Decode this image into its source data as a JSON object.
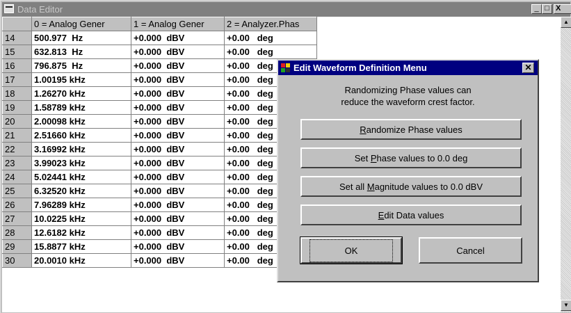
{
  "window": {
    "title": "Data Editor",
    "minimize_glyph": "_",
    "maximize_glyph": "□",
    "close_glyph": "X"
  },
  "grid": {
    "columns": [
      "",
      "0 = Analog Gener",
      "1 = Analog Gener",
      "2 = Analyzer.Phas"
    ],
    "rows": [
      {
        "num": "14",
        "c0": "500.977  Hz",
        "c1": "+0.000  dBV",
        "c2": "+0.00   deg"
      },
      {
        "num": "15",
        "c0": "632.813  Hz",
        "c1": "+0.000  dBV",
        "c2": "+0.00   deg"
      },
      {
        "num": "16",
        "c0": "796.875  Hz",
        "c1": "+0.000  dBV",
        "c2": "+0.00   deg"
      },
      {
        "num": "17",
        "c0": "1.00195 kHz",
        "c1": "+0.000  dBV",
        "c2": "+0.00   deg"
      },
      {
        "num": "18",
        "c0": "1.26270 kHz",
        "c1": "+0.000  dBV",
        "c2": "+0.00   deg"
      },
      {
        "num": "19",
        "c0": "1.58789 kHz",
        "c1": "+0.000  dBV",
        "c2": "+0.00   deg"
      },
      {
        "num": "20",
        "c0": "2.00098 kHz",
        "c1": "+0.000  dBV",
        "c2": "+0.00   deg"
      },
      {
        "num": "21",
        "c0": "2.51660 kHz",
        "c1": "+0.000  dBV",
        "c2": "+0.00   deg"
      },
      {
        "num": "22",
        "c0": "3.16992 kHz",
        "c1": "+0.000  dBV",
        "c2": "+0.00   deg"
      },
      {
        "num": "23",
        "c0": "3.99023 kHz",
        "c1": "+0.000  dBV",
        "c2": "+0.00   deg"
      },
      {
        "num": "24",
        "c0": "5.02441 kHz",
        "c1": "+0.000  dBV",
        "c2": "+0.00   deg"
      },
      {
        "num": "25",
        "c0": "6.32520 kHz",
        "c1": "+0.000  dBV",
        "c2": "+0.00   deg"
      },
      {
        "num": "26",
        "c0": "7.96289 kHz",
        "c1": "+0.000  dBV",
        "c2": "+0.00   deg"
      },
      {
        "num": "27",
        "c0": "10.0225 kHz",
        "c1": "+0.000  dBV",
        "c2": "+0.00   deg"
      },
      {
        "num": "28",
        "c0": "12.6182 kHz",
        "c1": "+0.000  dBV",
        "c2": "+0.00   deg"
      },
      {
        "num": "29",
        "c0": "15.8877 kHz",
        "c1": "+0.000  dBV",
        "c2": "+0.00   deg"
      },
      {
        "num": "30",
        "c0": "20.0010 kHz",
        "c1": "+0.000  dBV",
        "c2": "+0.00   deg"
      }
    ]
  },
  "dialog": {
    "title": "Edit Waveform Definition Menu",
    "close_glyph": "✕",
    "message_line1": "Randomizing Phase values can",
    "message_line2": "reduce the waveform crest factor.",
    "randomize": {
      "pre": "",
      "key": "R",
      "post": "andomize Phase values"
    },
    "set_phase": {
      "pre": "Set ",
      "key": "P",
      "post": "hase values to 0.0 deg"
    },
    "set_magnitude": {
      "pre": "Set all ",
      "key": "M",
      "post": "agnitude values to 0.0 dBV"
    },
    "edit_data": {
      "pre": "",
      "key": "E",
      "post": "dit Data values"
    },
    "ok_label": "OK",
    "cancel_label": "Cancel"
  },
  "scrollbar": {
    "up_glyph": "▲",
    "down_glyph": "▼"
  },
  "colors": {
    "dialog_title_bg": "#000080",
    "inactive_title_bg": "#808080",
    "face": "#c0c0c0"
  }
}
